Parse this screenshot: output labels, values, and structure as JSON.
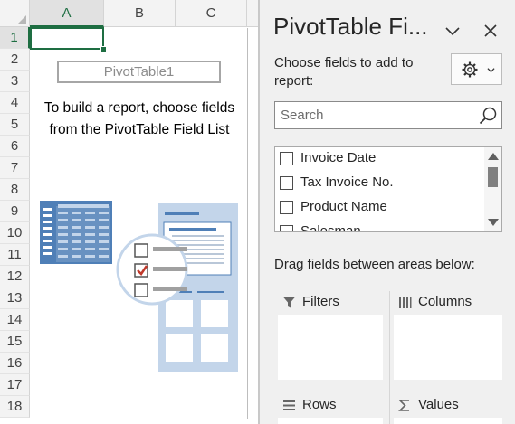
{
  "sheet": {
    "columns": [
      "A",
      "B",
      "C"
    ],
    "rows": [
      "1",
      "2",
      "3",
      "4",
      "5",
      "6",
      "7",
      "8",
      "9",
      "10",
      "11",
      "12",
      "13",
      "14",
      "15",
      "16",
      "17",
      "18"
    ],
    "pivot_name": "PivotTable1",
    "instruction": "To build a report, choose fields from the PivotTable Field List"
  },
  "pane": {
    "title": "PivotTable Fi...",
    "choose_label": "Choose fields to add to report:",
    "search_placeholder": "Search",
    "fields": [
      {
        "label": "Invoice Date",
        "checked": false
      },
      {
        "label": "Tax Invoice No.",
        "checked": false
      },
      {
        "label": "Product Name",
        "checked": false
      },
      {
        "label": "Salesman",
        "checked": false
      }
    ],
    "drag_label": "Drag fields between areas below:",
    "areas": {
      "filters": "Filters",
      "columns": "Columns",
      "rows": "Rows",
      "values": "Values"
    }
  },
  "colors": {
    "excel_green": "#1e6e42",
    "illustration_blue": "#4f7fb7",
    "illustration_light": "#c3d5ea",
    "check_red": "#c0392b"
  },
  "icons": [
    "gear-icon",
    "chevron-down-icon",
    "close-icon",
    "search-icon",
    "filter-icon",
    "columns-icon",
    "rows-icon",
    "sigma-icon"
  ]
}
